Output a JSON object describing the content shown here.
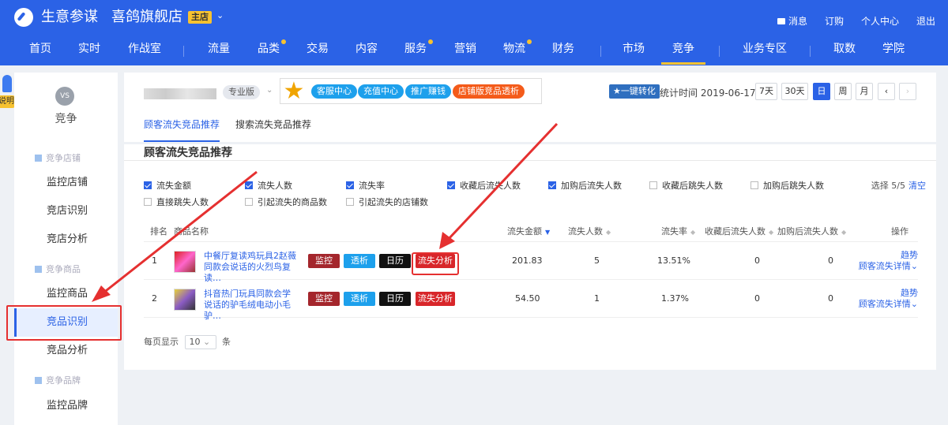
{
  "header": {
    "brand": "生意参谋",
    "store": "喜鸽旗舰店",
    "store_badge": "主店",
    "top_links": {
      "message": "消息",
      "subscribe": "订购",
      "personal": "个人中心",
      "logout": "退出"
    },
    "nav": [
      "首页",
      "实时",
      "作战室",
      "流量",
      "品类",
      "交易",
      "内容",
      "服务",
      "营销",
      "物流",
      "财务",
      "市场",
      "竞争",
      "业务专区",
      "取数",
      "学院"
    ],
    "active_nav": "竞争"
  },
  "float_badge": "说明",
  "sidebar": {
    "logo_text": "VS",
    "title": "竞争",
    "groups": {
      "shop": "竞争店铺",
      "product": "竞争商品",
      "brand": "竞争品牌"
    },
    "items": {
      "monitor_shop": "监控店铺",
      "shop_identify": "竞店识别",
      "shop_analysis": "竞店分析",
      "monitor_product": "监控商品",
      "product_identify": "竞品识别",
      "product_analysis": "竞品分析",
      "monitor_brand": "监控品牌"
    },
    "active_item": "竞品识别"
  },
  "toolbar": {
    "edition": "专业版",
    "promo_star": "★",
    "promo_buttons": [
      "客服中心",
      "充值中心",
      "推广赚钱",
      "店铺版竞品透析"
    ],
    "convert": "一键转化",
    "stat_time": "统计时间 2019-06-17",
    "ranges": [
      "7天",
      "30天",
      "日",
      "周",
      "月",
      "‹",
      "›"
    ],
    "active_range": "日"
  },
  "subtabs": [
    "顾客流失竞品推荐",
    "搜索流失竞品推荐"
  ],
  "panel": {
    "title": "顾客流失竞品推荐",
    "filters": [
      {
        "label": "流失金额",
        "checked": true
      },
      {
        "label": "流失人数",
        "checked": true
      },
      {
        "label": "流失率",
        "checked": true
      },
      {
        "label": "收藏后流失人数",
        "checked": true
      },
      {
        "label": "加购后流失人数",
        "checked": true
      },
      {
        "label": "收藏后跳失人数",
        "checked": false
      },
      {
        "label": "加购后跳失人数",
        "checked": false
      },
      {
        "label": "直接跳失人数",
        "checked": false
      },
      {
        "label": "引起流失的商品数",
        "checked": false
      },
      {
        "label": "引起流失的店铺数",
        "checked": false
      }
    ],
    "selection": "选择 5/5",
    "clear": "清空",
    "columns": {
      "rank": "排名",
      "name": "商品名称",
      "loss_amount": "流失金额",
      "loss_people": "流失人数",
      "loss_rate": "流失率",
      "fav_loss": "收藏后流失人数",
      "cart_loss": "加购后流失人数",
      "ops": "操作"
    },
    "row_tags": {
      "monitor": "监控",
      "trans": "透析",
      "calendar": "日历",
      "loss": "流失分析"
    },
    "row_ops": {
      "trend": "趋势",
      "detail": "顾客流失详情"
    },
    "rows": [
      {
        "rank": "1",
        "name": "中餐厅复读鸡玩具2赵薇同款会说话的火烈鸟复读…",
        "loss_amount": "201.83",
        "loss_people": "5",
        "loss_rate": "13.51%",
        "fav_loss": "0",
        "cart_loss": "0"
      },
      {
        "rank": "2",
        "name": "抖音热门玩具同款会学说话的驴毛绒电动小毛驴…",
        "loss_amount": "54.50",
        "loss_people": "1",
        "loss_rate": "1.37%",
        "fav_loss": "0",
        "cart_loss": "0"
      }
    ],
    "pager": {
      "prefix": "每页显示",
      "size": "10",
      "suffix": "条"
    }
  }
}
